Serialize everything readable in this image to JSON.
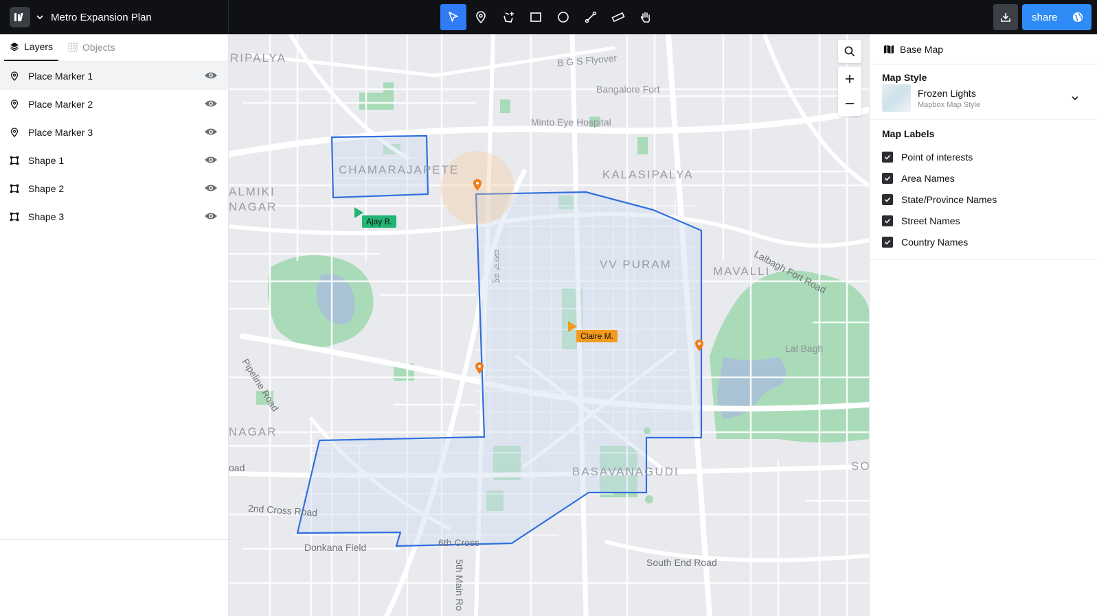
{
  "app": {
    "title": "Metro Expansion Plan",
    "logo_icon": "app-logo-icon"
  },
  "toolbar": {
    "tools": [
      {
        "name": "select",
        "icon": "cursor-icon",
        "active": true
      },
      {
        "name": "marker",
        "icon": "map-pin-icon",
        "active": false
      },
      {
        "name": "polygon",
        "icon": "polygon-add-icon",
        "active": false
      },
      {
        "name": "rectangle",
        "icon": "rectangle-icon",
        "active": false
      },
      {
        "name": "circle",
        "icon": "circle-icon",
        "active": false
      },
      {
        "name": "line",
        "icon": "line-icon",
        "active": false
      },
      {
        "name": "measure",
        "icon": "ruler-icon",
        "active": false
      },
      {
        "name": "pan",
        "icon": "hand-icon",
        "active": false
      }
    ],
    "share_label": "share",
    "accent": "#2f7cf6"
  },
  "left_panel": {
    "tabs": [
      {
        "label": "Layers",
        "icon": "layers-icon",
        "active": true
      },
      {
        "label": "Objects",
        "icon": "grid-icon",
        "active": false
      }
    ],
    "layers": [
      {
        "label": "Place Marker 1",
        "type": "marker",
        "visible": true,
        "selected": true
      },
      {
        "label": "Place Marker 2",
        "type": "marker",
        "visible": true,
        "selected": false
      },
      {
        "label": "Place Marker 3",
        "type": "marker",
        "visible": true,
        "selected": false
      },
      {
        "label": "Shape 1",
        "type": "shape",
        "visible": true,
        "selected": false
      },
      {
        "label": "Shape 2",
        "type": "shape",
        "visible": true,
        "selected": false
      },
      {
        "label": "Shape 3",
        "type": "shape",
        "visible": true,
        "selected": false
      }
    ]
  },
  "map": {
    "area_labels": [
      "RIPALYA",
      "B G S Flyover",
      "Bangalore Fort",
      "Minto Eye Hospital",
      "CHAMARAJAPETE",
      "KALASIPALYA",
      "ALMIKI",
      "NAGAR",
      "VV PURAM",
      "MAVALLI",
      "Lalbagh Fort Road",
      "Lal Bagh",
      "Pipeline Road",
      "NAGAR",
      "oad",
      "BASAVANAGUDI",
      "SO",
      "2nd Cross Road",
      "Donkana Field",
      "6th Cross",
      "5th Main Ro",
      "South End Road",
      "ದರ್ಶನ್ ರಸ್ತೆ"
    ],
    "collaborators": [
      {
        "name": "Ajay B.",
        "color": "#22b573"
      },
      {
        "name": "Claire M.",
        "color": "#f39a1f"
      }
    ],
    "shape_color": "#2f7cf6",
    "marker_color": "#f07c1a",
    "park_color": "#a7dbb6",
    "controls": {
      "search": "search-icon",
      "zoom_in": "plus-icon",
      "zoom_out": "minus-icon"
    }
  },
  "right_panel": {
    "header": "Base Map",
    "map_style_title": "Map Style",
    "style_name": "Frozen Lights",
    "style_sub": "Mapbox Map Style",
    "labels_title": "Map Labels",
    "labels": [
      {
        "label": "Point of interests",
        "checked": true
      },
      {
        "label": "Area Names",
        "checked": true
      },
      {
        "label": "State/Province Names",
        "checked": true
      },
      {
        "label": "Street Names",
        "checked": true
      },
      {
        "label": "Country Names",
        "checked": true
      }
    ]
  }
}
